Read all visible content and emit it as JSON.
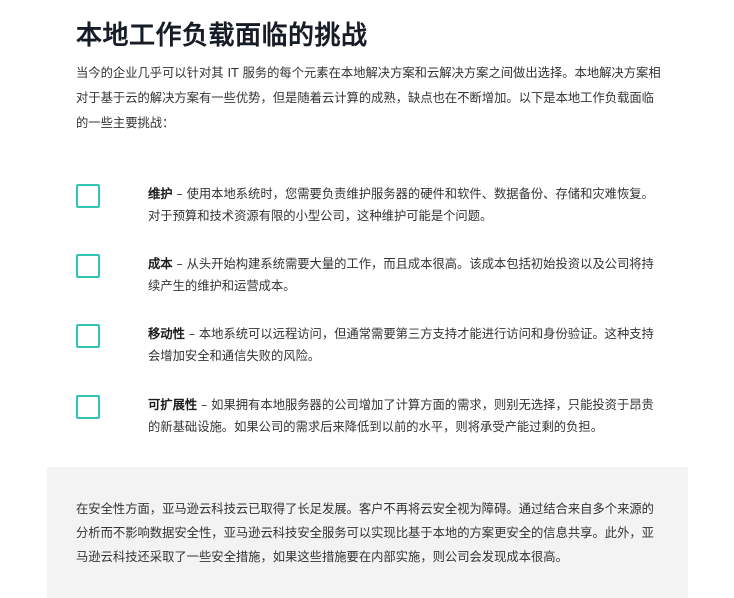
{
  "article": {
    "title": "本地工作负载面临的挑战",
    "intro": "当今的企业几乎可以针对其 IT 服务的每个元素在本地解决方案和云解决方案之间做出选择。本地解决方案相对于基于云的解决方案有一些优势，但是随着云计算的成熟，缺点也在不断增加。以下是本地工作负载面临的一些主要挑战："
  },
  "challenges": [
    {
      "term": "维护",
      "text": " – 使用本地系统时，您需要负责维护服务器的硬件和软件、数据备份、存储和灾难恢复。对于预算和技术资源有限的小型公司，这种维护可能是个问题。"
    },
    {
      "term": "成本",
      "text": " – 从头开始构建系统需要大量的工作，而且成本很高。该成本包括初始投资以及公司将持续产生的维护和运营成本。"
    },
    {
      "term": "移动性",
      "text": " – 本地系统可以远程访问，但通常需要第三方支持才能进行访问和身份验证。这种支持会增加安全和通信失败的风险。"
    },
    {
      "term": "可扩展性",
      "text": " – 如果拥有本地服务器的公司增加了计算方面的需求，则别无选择，只能投资于昂贵的新基础设施。如果公司的需求后来降低到以前的水平，则将承受产能过剩的负担。"
    }
  ],
  "callout": {
    "text": "在安全性方面，亚马逊云科技云已取得了长足发展。客户不再将云安全视为障碍。通过结合来自多个来源的分析而不影响数据安全性，亚马逊云科技安全服务可以实现比基于本地的方案更安全的信息共享。此外，亚马逊云科技还采取了一些安全措施，如果这些措施要在内部实施，则公司会发现成本很高。"
  },
  "colors": {
    "checkbox_border": "#31c3b4",
    "callout_background": "#f3f3f3",
    "title_text": "#161d26",
    "body_text": "#333333"
  }
}
